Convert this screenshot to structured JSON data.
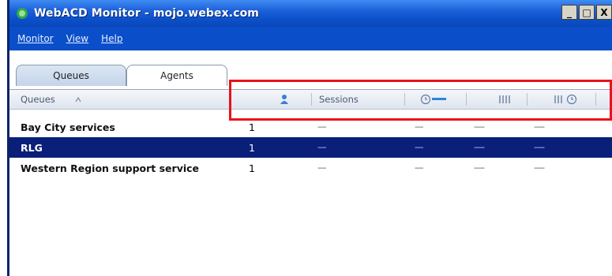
{
  "window": {
    "title": "WebACD Monitor - mojo.webex.com",
    "controls": [
      "_",
      "□",
      "X"
    ]
  },
  "menu": [
    "Monitor",
    "View",
    "Help"
  ],
  "tabs": [
    {
      "label": "Queues",
      "active": true
    },
    {
      "label": "Agents",
      "active": false
    }
  ],
  "table": {
    "headers": {
      "queues": "Queues",
      "sessions": "Sessions"
    },
    "header_icons": [
      "sort-icon",
      "agent-icon",
      "wait-time-icon",
      "agents-available-icon",
      "agents-wait-icon"
    ],
    "rows": [
      {
        "name": "Bay City services",
        "count": "1",
        "c1": "----",
        "c2": "----",
        "c3": "-----",
        "c4": "-----",
        "selected": false
      },
      {
        "name": "RLG",
        "count": "1",
        "c1": "----",
        "c2": "----",
        "c3": "-----",
        "c4": "-----",
        "selected": true
      },
      {
        "name": "Western Region support service",
        "count": "1",
        "c1": "----",
        "c2": "----",
        "c3": "-----",
        "c4": "-----",
        "selected": false
      }
    ]
  },
  "colors": {
    "titlebar": "#0a4fc9",
    "selection": "#0a1f7a",
    "highlight_box": "#e8121c"
  }
}
